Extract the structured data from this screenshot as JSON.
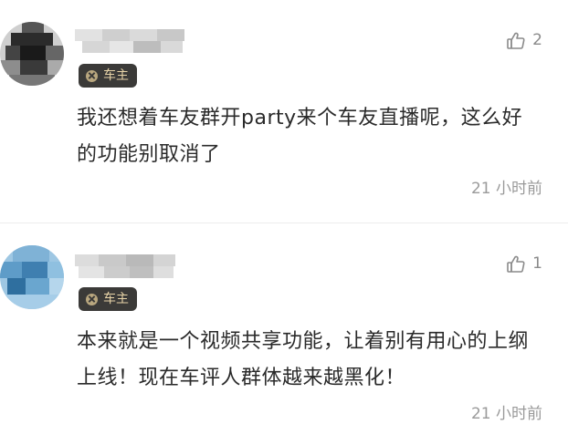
{
  "comments": [
    {
      "badge": "车主",
      "likes": "2",
      "content": "我还想着车友群开party来个车友直播呢，这么好的功能别取消了",
      "time": "21 小时前"
    },
    {
      "badge": "车主",
      "likes": "1",
      "content": "本来就是一个视频共享功能，让着别有用心的上纲上线！现在车评人群体越来越黑化！",
      "time": "21 小时前"
    }
  ],
  "icons": {
    "like": "thumbs-up-icon",
    "badge": "owner-badge-icon"
  },
  "colors": {
    "badge_bg": "#3b3a38",
    "badge_text": "#e7d3a7",
    "meta_text": "#9a9a9a",
    "body_text": "#2a2a2a"
  }
}
